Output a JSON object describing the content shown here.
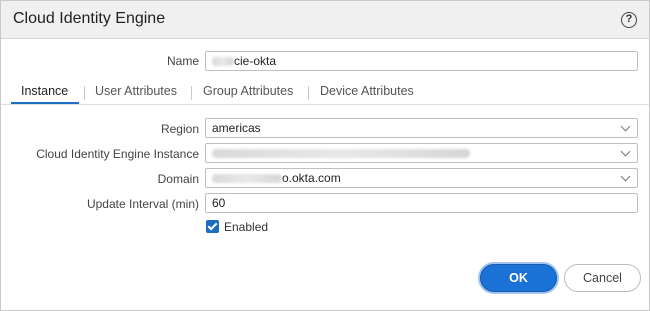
{
  "dialog": {
    "title": "Cloud Identity Engine",
    "help_icon": "?"
  },
  "name_field": {
    "label": "Name",
    "value_suffix": "cie-okta"
  },
  "tabs": [
    {
      "label": "Instance",
      "active": true
    },
    {
      "label": "User Attributes",
      "active": false
    },
    {
      "label": "Group Attributes",
      "active": false
    },
    {
      "label": "Device Attributes",
      "active": false
    }
  ],
  "form": {
    "region": {
      "label": "Region",
      "value": "americas"
    },
    "instance": {
      "label": "Cloud Identity Engine Instance"
    },
    "domain": {
      "label": "Domain",
      "value_suffix": "o.okta.com"
    },
    "update_interval": {
      "label": "Update Interval (min)",
      "value": "60"
    },
    "enabled": {
      "label": "Enabled",
      "checked": true
    }
  },
  "buttons": {
    "ok": "OK",
    "cancel": "Cancel"
  },
  "colors": {
    "accent": "#1b72d6",
    "titlebar": "#f0f0f0"
  }
}
